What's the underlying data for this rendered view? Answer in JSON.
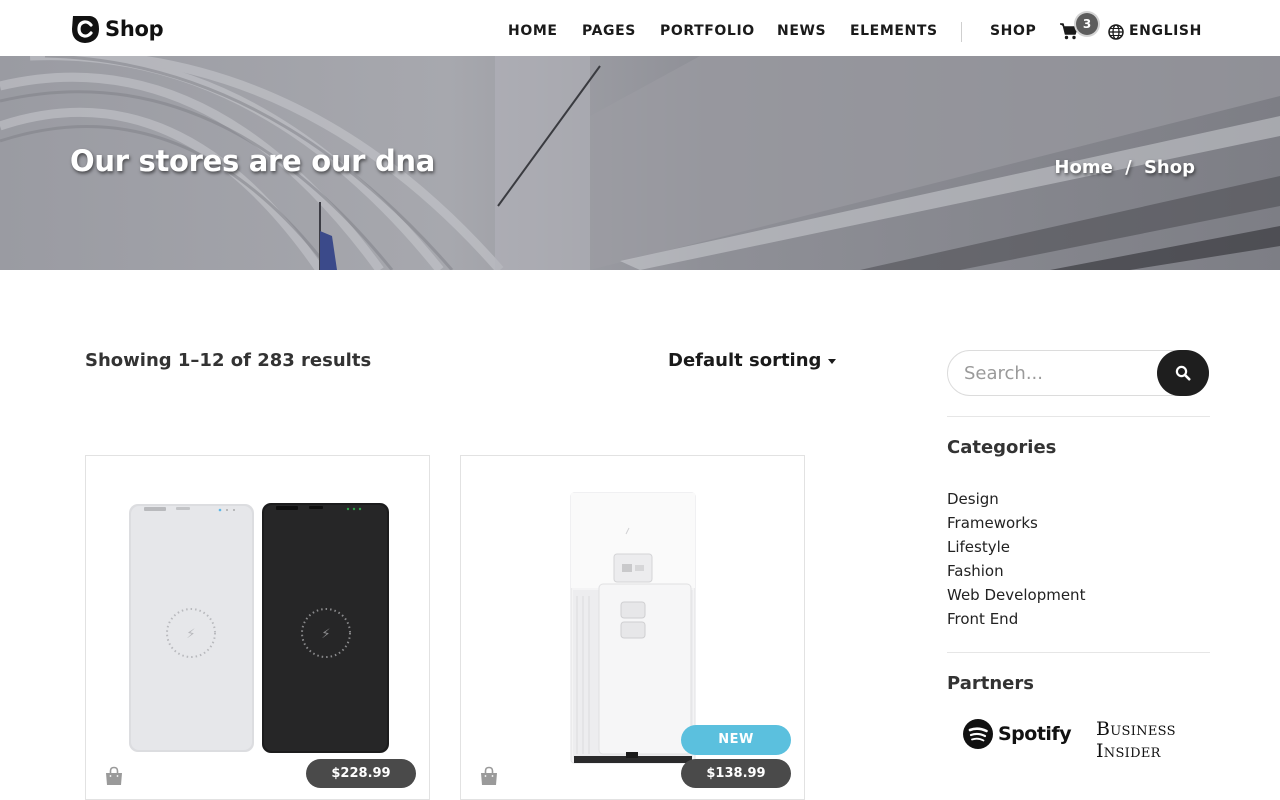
{
  "brand": {
    "name": "Shop"
  },
  "nav": {
    "items": [
      "HOME",
      "PAGES",
      "PORTFOLIO",
      "NEWS",
      "ELEMENTS"
    ],
    "shop_label": "SHOP",
    "cart_count": "3",
    "language": "ENGLISH"
  },
  "hero": {
    "title": "Our stores are our dna",
    "breadcrumb": {
      "home": "Home",
      "separator": "/",
      "current": "Shop"
    }
  },
  "toolbar": {
    "result_count": "Showing 1–12 of 283 results",
    "sorting": "Default sorting"
  },
  "products": [
    {
      "price": "$228.99",
      "badge": ""
    },
    {
      "price": "$138.99",
      "badge": "NEW"
    }
  ],
  "sidebar": {
    "search_placeholder": "Search...",
    "categories_title": "Categories",
    "categories": [
      "Design",
      "Frameworks",
      "Lifestyle",
      "Fashion",
      "Web Development",
      "Front End"
    ],
    "partners_title": "Partners",
    "partners": {
      "spotify": "Spotify",
      "bi_line1": "Business",
      "bi_line2": "Insider"
    }
  },
  "colors": {
    "accent": "#5bc0de",
    "price_bg": "#4a4a4a",
    "dark": "#1e1e1e"
  }
}
